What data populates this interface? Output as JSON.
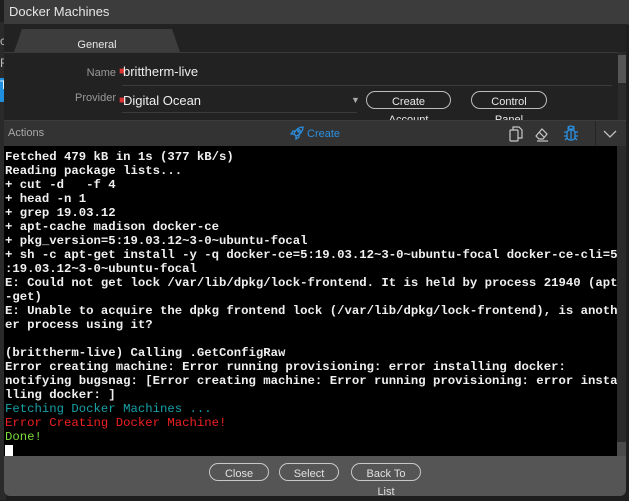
{
  "window": {
    "title": "Docker Machines"
  },
  "background": {
    "fragments": [
      "c",
      "F",
      "T"
    ]
  },
  "tabs": [
    {
      "label": "General",
      "active": true
    }
  ],
  "form": {
    "name": {
      "label": "Name",
      "value": "brittherm-live",
      "required": true
    },
    "provider": {
      "label": "Provider",
      "value": "Digital Ocean",
      "required": true
    }
  },
  "buttons": {
    "create_account": "Create Account",
    "control_panel": "Control Panel"
  },
  "actions": {
    "title": "Actions",
    "create_label": "Create",
    "accent_color": "#2b8fe0",
    "icons": [
      "copy-icon",
      "eraser-icon",
      "bug-icon",
      "chevron-down-icon"
    ]
  },
  "terminal": {
    "lines": [
      {
        "text": "Fetched 479 kB in 1s (377 kB/s)",
        "style": "normal"
      },
      {
        "text": "Reading package lists...",
        "style": "normal"
      },
      {
        "text": "+ cut -d   -f 4",
        "style": "normal"
      },
      {
        "text": "+ head -n 1",
        "style": "normal"
      },
      {
        "text": "+ grep 19.03.12",
        "style": "normal"
      },
      {
        "text": "+ apt-cache madison docker-ce",
        "style": "normal"
      },
      {
        "text": "+ pkg_version=5:19.03.12~3-0~ubuntu-focal",
        "style": "normal"
      },
      {
        "text": "+ sh -c apt-get install -y -q docker-ce=5:19.03.12~3-0~ubuntu-focal docker-ce-cli=5",
        "style": "normal"
      },
      {
        "text": ":19.03.12~3-0~ubuntu-focal",
        "style": "normal"
      },
      {
        "text": "E: Could not get lock /var/lib/dpkg/lock-frontend. It is held by process 21940 (apt",
        "style": "normal"
      },
      {
        "text": "-get)",
        "style": "normal"
      },
      {
        "text": "E: Unable to acquire the dpkg frontend lock (/var/lib/dpkg/lock-frontend), is anoth",
        "style": "normal"
      },
      {
        "text": "er process using it?",
        "style": "normal"
      },
      {
        "text": " ",
        "style": "normal"
      },
      {
        "text": "(brittherm-live) Calling .GetConfigRaw",
        "style": "normal"
      },
      {
        "text": "Error creating machine: Error running provisioning: error installing docker:",
        "style": "normal"
      },
      {
        "text": "notifying bugsnag: [Error creating machine: Error running provisioning: error insta",
        "style": "normal"
      },
      {
        "text": "lling docker: ]",
        "style": "normal"
      },
      {
        "text": "Fetching Docker Machines ...",
        "style": "cyan"
      },
      {
        "text": "Error Creating Docker Machine!",
        "style": "red"
      },
      {
        "text": "Done!",
        "style": "green"
      }
    ],
    "colors": {
      "cyan": "#18a0a8",
      "red": "#f02020",
      "green": "#7fdc3a"
    }
  },
  "footer": {
    "close": "Close",
    "select": "Select",
    "back_to_list": "Back To List"
  }
}
